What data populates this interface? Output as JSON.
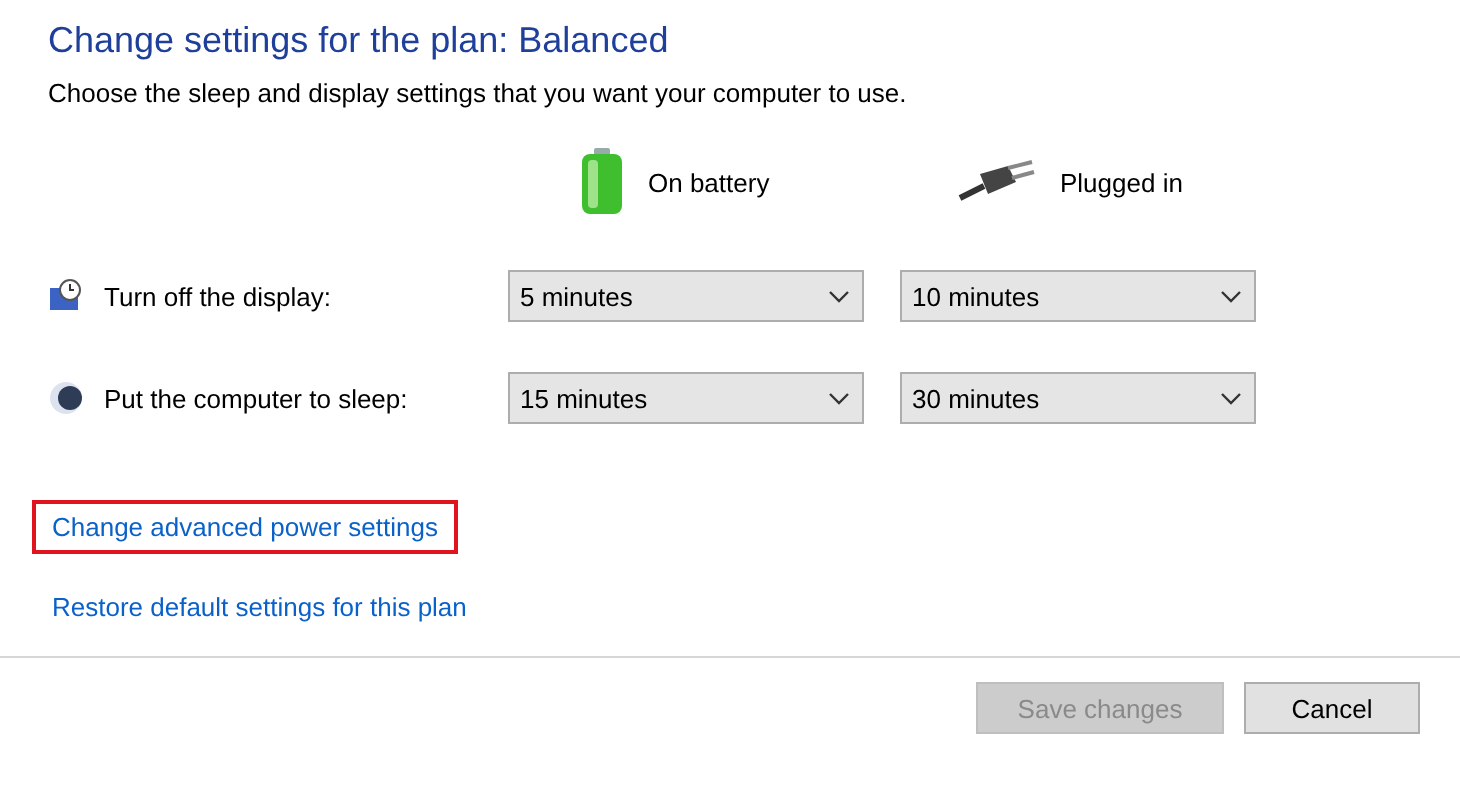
{
  "title": "Change settings for the plan: Balanced",
  "subtitle": "Choose the sleep and display settings that you want your computer to use.",
  "columns": [
    {
      "kind": "battery",
      "label": "On battery"
    },
    {
      "kind": "plug",
      "label": "Plugged in"
    }
  ],
  "settings": [
    {
      "kind": "display",
      "label": "Turn off the display:",
      "values": [
        "5 minutes",
        "10 minutes"
      ]
    },
    {
      "kind": "sleep",
      "label": "Put the computer to sleep:",
      "values": [
        "15 minutes",
        "30 minutes"
      ]
    }
  ],
  "links": [
    {
      "label": "Change advanced power settings",
      "highlighted": true
    },
    {
      "label": "Restore default settings for this plan",
      "highlighted": false
    }
  ],
  "buttons": [
    {
      "label": "Save changes",
      "disabled": true
    },
    {
      "label": "Cancel",
      "disabled": false
    }
  ]
}
